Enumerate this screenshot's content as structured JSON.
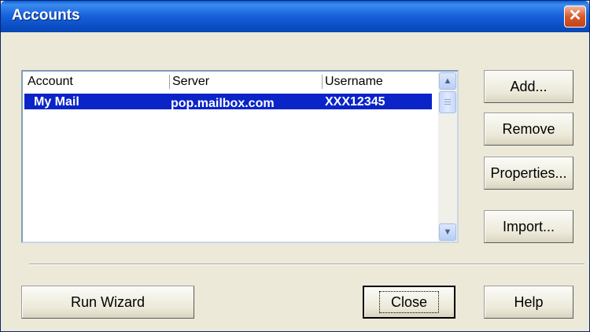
{
  "window": {
    "title": "Accounts",
    "close_glyph": "✕"
  },
  "accounts_list": {
    "columns": [
      "Account",
      "Server",
      "Username"
    ],
    "rows": [
      {
        "account": "My Mail",
        "server": "pop.mailbox.com",
        "username": "XXX12345",
        "selected": true
      }
    ],
    "scroll_up_glyph": "▲",
    "scroll_down_glyph": "▼"
  },
  "buttons": {
    "add": "Add...",
    "remove": "Remove",
    "properties": "Properties...",
    "import": "Import...",
    "run_wizard": "Run Wizard",
    "close": "Close",
    "help": "Help"
  },
  "colors": {
    "selection": "#0a24c8",
    "titlebar": "#0a4fc4"
  }
}
